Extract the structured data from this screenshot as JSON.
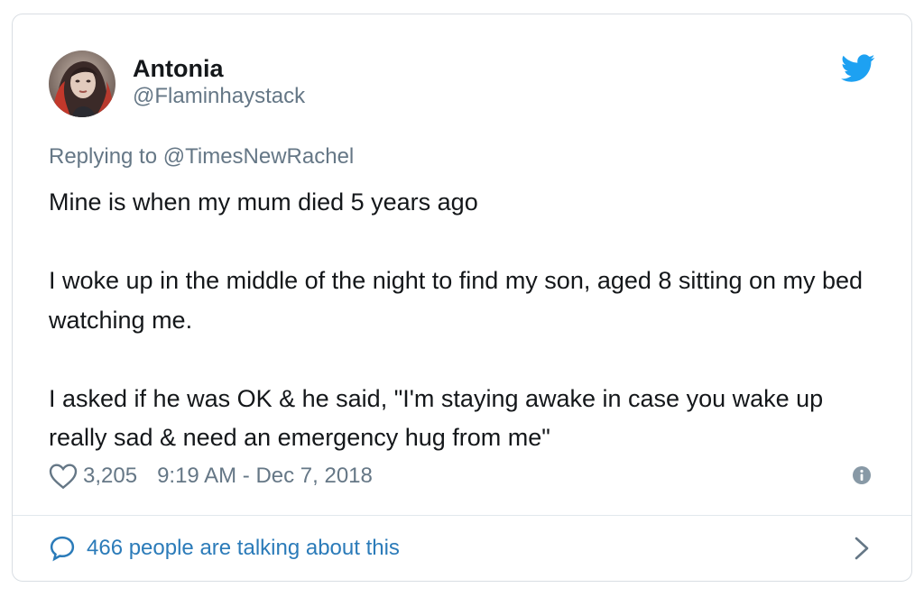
{
  "author": {
    "name": "Antonia",
    "handle": "@Flaminhaystack",
    "avatar_icon": "profile-photo"
  },
  "reply": {
    "label": "Replying to @TimesNewRachel"
  },
  "tweet": {
    "paragraphs": [
      "Mine is when my mum died 5 years ago",
      "I woke up in the middle of the night to find my son, aged 8 sitting on my bed watching me.",
      "I asked if he was OK & he said, \"I'm staying awake in case you wake up really sad & need an emergency hug from me\""
    ]
  },
  "meta": {
    "likes": "3,205",
    "timestamp": "9:19 AM - Dec 7, 2018"
  },
  "footer": {
    "talking_label": "466 people are talking about this"
  },
  "colors": {
    "brand": "#1da1f2",
    "link": "#2b7bb9",
    "muted": "#657786",
    "text": "#14171a",
    "border": "#d9dee3"
  },
  "icons": [
    "twitter-bird-icon",
    "heart-icon",
    "info-icon",
    "comment-bubble-icon",
    "chevron-right-icon"
  ]
}
